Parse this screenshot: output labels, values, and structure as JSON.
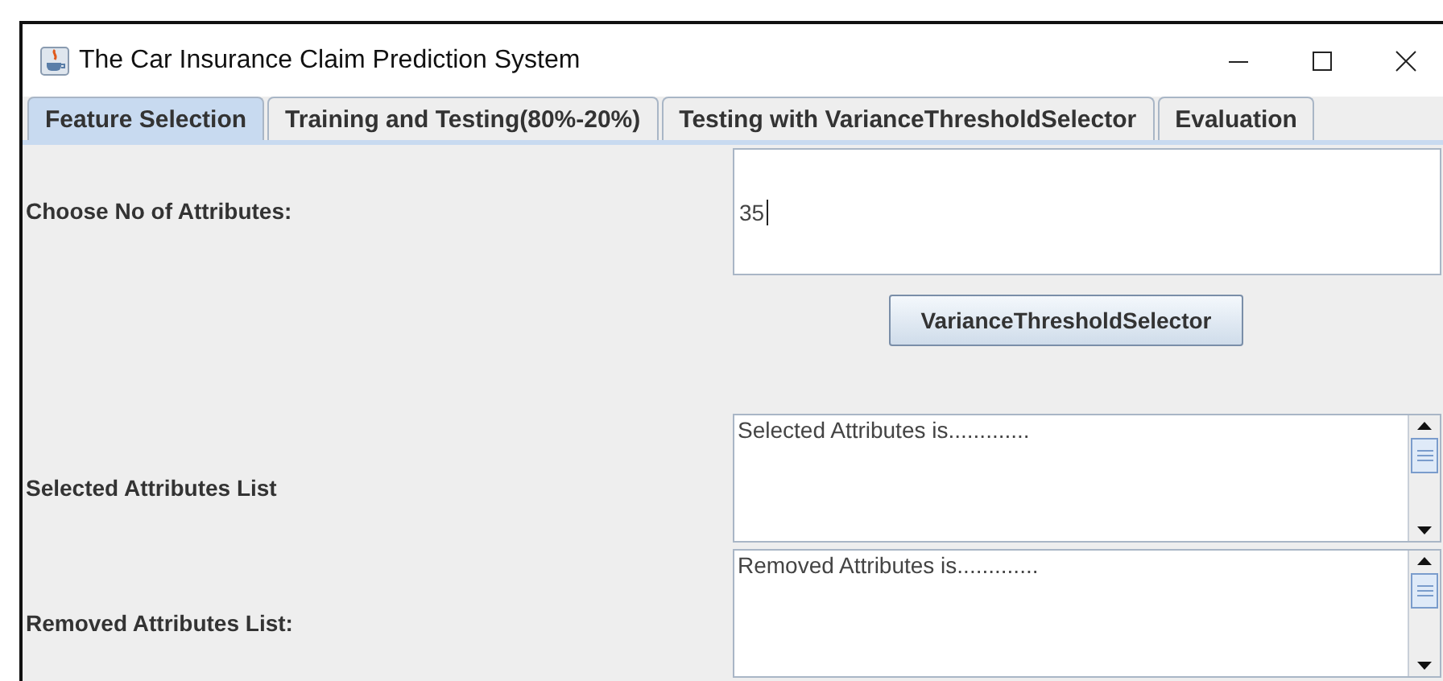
{
  "window": {
    "title": "The Car Insurance Claim Prediction System"
  },
  "tabs": [
    {
      "label": "Feature Selection",
      "selected": true
    },
    {
      "label": "Training and Testing(80%-20%)",
      "selected": false
    },
    {
      "label": "Testing with VarianceThresholdSelector",
      "selected": false
    },
    {
      "label": "Evaluation",
      "selected": false
    }
  ],
  "attributes_field": {
    "label": "Choose No of Attributes:",
    "value": "35"
  },
  "select_button": "VarianceThresholdSelector",
  "lists": [
    {
      "label": "Selected Attributes List",
      "text": "Selected Attributes is............."
    },
    {
      "label": "Removed Attributes List:",
      "text": "Removed Attributes is............."
    }
  ]
}
